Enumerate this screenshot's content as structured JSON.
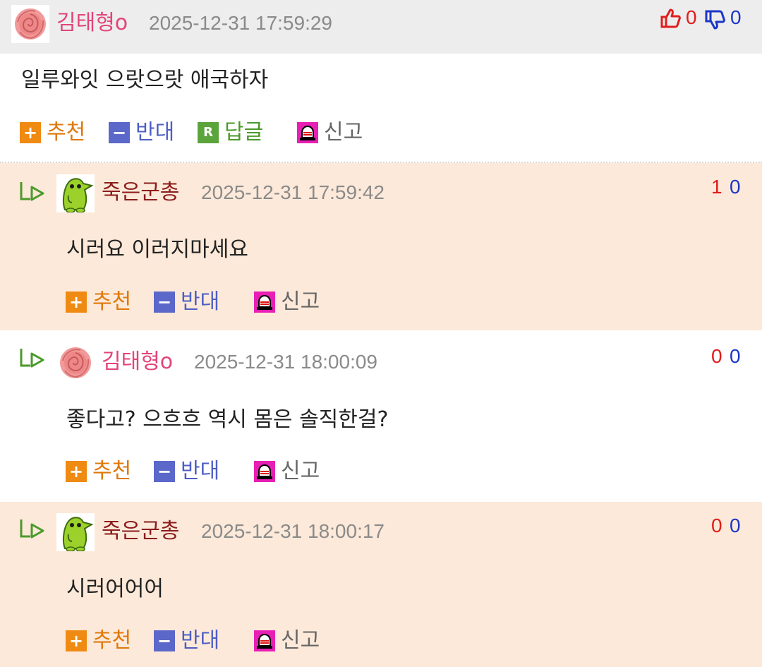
{
  "colors": {
    "header_bg": "#ededed",
    "reply_bg": "#fce9d9",
    "white_bg": "#ffffff",
    "nick_pink": "#e2447a",
    "nick_maroon": "#8c1c1c",
    "vote_up": "#e11d1d",
    "vote_down": "#1c36c8",
    "recommend": "#ef8a12",
    "oppose": "#5b68c9",
    "reply": "#5ba43b",
    "report_icon_bg": "#e81fb4"
  },
  "actions": {
    "recommend": "추천",
    "oppose": "반대",
    "reply": "답글",
    "report": "신고"
  },
  "main_comment": {
    "author": "김태형o",
    "avatar_icon": "rose-avatar",
    "timestamp": "2025-12-31 17:59:29",
    "upvotes": "0",
    "downvotes": "0",
    "text": "일루와잇 으랏으랏 애국하자"
  },
  "replies": [
    {
      "author": "죽은군총",
      "avatar_icon": "green-creature-avatar",
      "timestamp": "2025-12-31 17:59:42",
      "upvotes": "1",
      "downvotes": "0",
      "text": "시러요 이러지마세요"
    },
    {
      "author": "김태형o",
      "avatar_icon": "rose-avatar",
      "timestamp": "2025-12-31 18:00:09",
      "upvotes": "0",
      "downvotes": "0",
      "text": "좋다고? 으흐흐 역시 몸은 솔직한걸?"
    },
    {
      "author": "죽은군총",
      "avatar_icon": "green-creature-avatar",
      "timestamp": "2025-12-31 18:00:17",
      "upvotes": "0",
      "downvotes": "0",
      "text": "시러어어어"
    }
  ]
}
